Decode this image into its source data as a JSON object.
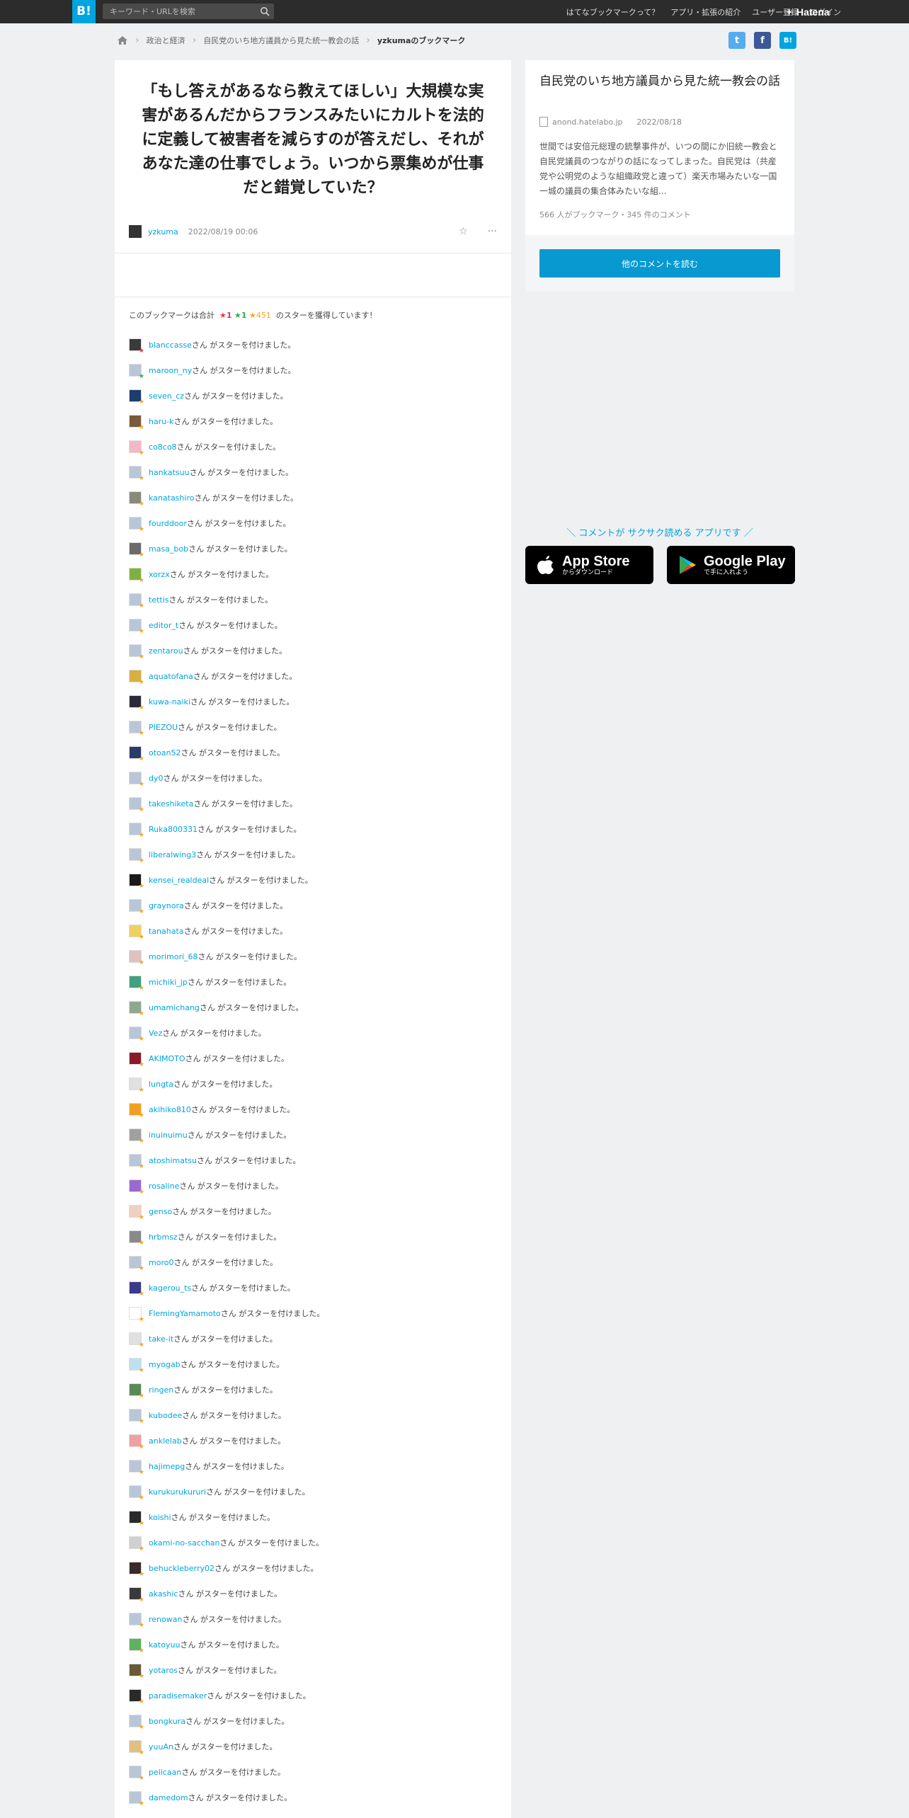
{
  "topbar": {
    "logo": "B!",
    "search_placeholder": "キーワード・URLを検索",
    "nav": [
      "はてなブックマークって？",
      "アプリ・拡張の紹介",
      "ユーザー登録",
      "ログイン"
    ],
    "brand": "Hatena"
  },
  "breadcrumb": {
    "items": [
      "政治と経済",
      "自民党のいち地方議員から見た統一教会の話",
      "yzkumaのブックマーク"
    ]
  },
  "share": {
    "twitter": "t",
    "facebook": "f",
    "hatena": "B!"
  },
  "bookmark": {
    "comment": "「もし答えがあるなら教えてほしい」大規模な実害があるんだからフランスみたいにカルトを法的に定義して被害者を減らすのが答えだし、それがあなた達の仕事でしょう。いつから票集めが仕事だと錯覚していた？",
    "user": "yzkuma",
    "date": "2022/08/19 00:06"
  },
  "stars_summary": {
    "prefix": "このブックマークは合計",
    "red": "★1",
    "green": "★1",
    "yellow": "★451",
    "suffix": "のスターを獲得しています！"
  },
  "star_suffix": "さん がスターを付けました。",
  "star_users": [
    {
      "name": "blanccasse",
      "color": "#e5384b",
      "avatar": "#3a3a3a"
    },
    {
      "name": "maroon_ny",
      "color": "#2eb24e",
      "avatar": "#b8c6d8"
    },
    {
      "name": "seven_cz",
      "color": "#f5a623",
      "avatar": "#1c3d6e"
    },
    {
      "name": "haru-k",
      "color": "#f5a623",
      "avatar": "#7a5a3a"
    },
    {
      "name": "co8co8",
      "color": "#f5a623",
      "avatar": "#f3b7c6"
    },
    {
      "name": "hankatsuu",
      "color": "#f5a623",
      "avatar": "#b8c6d8"
    },
    {
      "name": "kanatashiro",
      "color": "#f5a623",
      "avatar": "#8a8a7a"
    },
    {
      "name": "fourddoor",
      "color": "#f5a623",
      "avatar": "#b8c6d8"
    },
    {
      "name": "masa_bob",
      "color": "#f5a623",
      "avatar": "#6a6a6a"
    },
    {
      "name": "xorzx",
      "color": "#f5a623",
      "avatar": "#7fb040"
    },
    {
      "name": "tettis",
      "color": "#f5a623",
      "avatar": "#b8c6d8"
    },
    {
      "name": "editor_t",
      "color": "#f5a623",
      "avatar": "#b8c6d8"
    },
    {
      "name": "zentarou",
      "color": "#f5a623",
      "avatar": "#b8c6d8"
    },
    {
      "name": "aquatofana",
      "color": "#f5a623",
      "avatar": "#d8b040"
    },
    {
      "name": "kuwa-naiki",
      "color": "#f5a623",
      "avatar": "#2a2a3a"
    },
    {
      "name": "PIEZOU",
      "color": "#f5a623",
      "avatar": "#b8c6d8"
    },
    {
      "name": "otoan52",
      "color": "#f5a623",
      "avatar": "#2a3a6a"
    },
    {
      "name": "dy0",
      "color": "#f5a623",
      "avatar": "#b8c6d8"
    },
    {
      "name": "takeshiketa",
      "color": "#f5a623",
      "avatar": "#b8c6d8"
    },
    {
      "name": "Ruka800331",
      "color": "#f5a623",
      "avatar": "#b8c6d8"
    },
    {
      "name": "liberalwing3",
      "color": "#f5a623",
      "avatar": "#b8c6d8"
    },
    {
      "name": "kensei_realdeal",
      "color": "#f5a623",
      "avatar": "#1a1a1a"
    },
    {
      "name": "graynora",
      "color": "#f5a623",
      "avatar": "#b8c6d8"
    },
    {
      "name": "tanahata",
      "color": "#f5a623",
      "avatar": "#f0d060"
    },
    {
      "name": "morimori_68",
      "color": "#f5a623",
      "avatar": "#e0c0c0"
    },
    {
      "name": "michiki_jp",
      "color": "#f5a623",
      "avatar": "#40a080"
    },
    {
      "name": "umamichang",
      "color": "#f5a623",
      "avatar": "#90a890"
    },
    {
      "name": "Vez",
      "color": "#f5a623",
      "avatar": "#b8c6d8"
    },
    {
      "name": "AKIMOTO",
      "color": "#f5a623",
      "avatar": "#8a1a2a"
    },
    {
      "name": "lungta",
      "color": "#f5a623",
      "avatar": "#e0e0e0"
    },
    {
      "name": "akihiko810",
      "color": "#f5a623",
      "avatar": "#f0a020"
    },
    {
      "name": "inuinuimu",
      "color": "#f5a623",
      "avatar": "#a0a0a0"
    },
    {
      "name": "atoshimatsu",
      "color": "#f5a623",
      "avatar": "#b8c6d8"
    },
    {
      "name": "rosaline",
      "color": "#f5a623",
      "avatar": "#9a6ad0"
    },
    {
      "name": "genso",
      "color": "#f5a623",
      "avatar": "#f0d0c0"
    },
    {
      "name": "hrbmsz",
      "color": "#f5a623",
      "avatar": "#8a8a8a"
    },
    {
      "name": "moro0",
      "color": "#f5a623",
      "avatar": "#b8c6d8"
    },
    {
      "name": "kagerou_ts",
      "color": "#f5a623",
      "avatar": "#3a3a8a"
    },
    {
      "name": "FlemingYamamoto",
      "color": "#f5a623",
      "avatar": "#ffffff"
    },
    {
      "name": "take-it",
      "color": "#f5a623",
      "avatar": "#e0e0e0"
    },
    {
      "name": "myogab",
      "color": "#f5a623",
      "avatar": "#c0e0f0"
    },
    {
      "name": "ringen",
      "color": "#f5a623",
      "avatar": "#5a8a5a"
    },
    {
      "name": "kubodee",
      "color": "#f5a623",
      "avatar": "#b8c6d8"
    },
    {
      "name": "anklelab",
      "color": "#f5a623",
      "avatar": "#f0a0a0"
    },
    {
      "name": "hajimepg",
      "color": "#f5a623",
      "avatar": "#b8c6d8"
    },
    {
      "name": "kurukurukururi",
      "color": "#f5a623",
      "avatar": "#b8c6d8"
    },
    {
      "name": "koishi",
      "color": "#f5a623",
      "avatar": "#2a2a2a"
    },
    {
      "name": "okami-no-sacchan",
      "color": "#f5a623",
      "avatar": "#d0d0d0"
    },
    {
      "name": "behuckleberry02",
      "color": "#f5a623",
      "avatar": "#3a2a2a"
    },
    {
      "name": "akashic",
      "color": "#f5a623",
      "avatar": "#3a3a3a"
    },
    {
      "name": "renowan",
      "color": "#f5a623",
      "avatar": "#b8c6d8"
    },
    {
      "name": "katoyuu",
      "color": "#f5a623",
      "avatar": "#60b060"
    },
    {
      "name": "yotaros",
      "color": "#f5a623",
      "avatar": "#6a5a3a"
    },
    {
      "name": "paradisemaker",
      "color": "#f5a623",
      "avatar": "#2a2a2a"
    },
    {
      "name": "bongkura",
      "color": "#f5a623",
      "avatar": "#b8c6d8"
    },
    {
      "name": "yuuAn",
      "color": "#f5a623",
      "avatar": "#e0c080"
    },
    {
      "name": "pelicaan",
      "color": "#f5a623",
      "avatar": "#b8c6d8"
    },
    {
      "name": "damedom",
      "color": "#f5a623",
      "avatar": "#b8c6d8"
    }
  ],
  "entry": {
    "title": "自民党のいち地方議員から見た統一教会の話",
    "domain": "anond.hatelabo.jp",
    "date": "2022/08/18",
    "description": "世間では安倍元総理の銃撃事件が、いつの間にか旧統一教会と自民党議員のつながりの話になってしまった。自民党は（共産党や公明党のような組織政党と違って）楽天市場みたいな一国一城の議員の集合体みたいな組...",
    "counts": "566 人がブックマーク・345 件のコメント",
    "read_more": "他のコメントを読む"
  },
  "promo": {
    "text": "＼ コメントが サクサク読める アプリです ／",
    "appstore_big": "App Store",
    "appstore_small": "からダウンロード",
    "gplay_big": "Google Play",
    "gplay_small": "で手に入れよう"
  }
}
